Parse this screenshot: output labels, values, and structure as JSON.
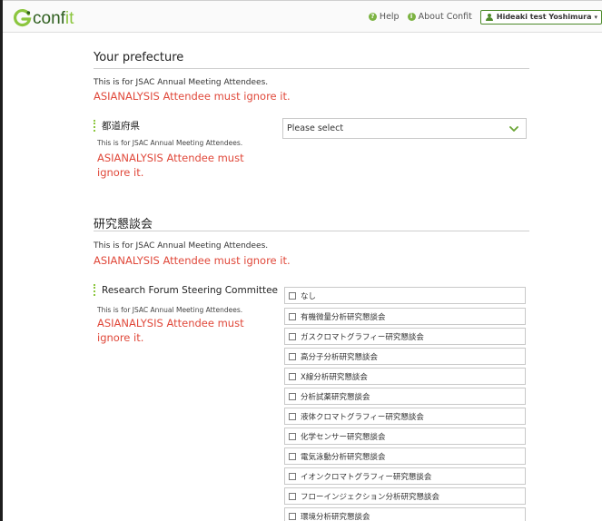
{
  "navbar": {
    "logo_text_main": "conf",
    "logo_text_accent": "it",
    "help_label": "Help",
    "about_label": "About Confit",
    "user_name": "Hideaki test Yoshimura"
  },
  "section_prefecture": {
    "title": "Your prefecture",
    "note": "This is for JSAC Annual Meeting Attendees.",
    "warning": "ASIANALYSIS Attendee must ignore it.",
    "field_label": "都道府県",
    "field_note": "This is for JSAC Annual Meeting Attendees.",
    "field_warning": "ASIANALYSIS Attendee must ignore it.",
    "select_value": "Please select"
  },
  "section_forum": {
    "title": "研究懇談会",
    "note": "This is for JSAC Annual Meeting Attendees.",
    "warning": "ASIANALYSIS Attendee must ignore it.",
    "field_label": "Research Forum Steering Committee",
    "field_note": "This is for JSAC Annual Meeting Attendees.",
    "field_warning": "ASIANALYSIS Attendee must ignore it.",
    "options": [
      "なし",
      "有機微量分析研究懇談会",
      "ガスクロマトグラフィー研究懇談会",
      "高分子分析研究懇談会",
      "X線分析研究懇談会",
      "分析試薬研究懇談会",
      "液体クロマトグラフィー研究懇談会",
      "化学センサー研究懇談会",
      "電気泳動分析研究懇談会",
      "イオンクロマトグラフィー研究懇談会",
      "フローインジェクション分析研究懇談会",
      "環境分析研究懇談会"
    ]
  },
  "colors": {
    "accent_green": "#8cc63f",
    "dark_green": "#4d8a2a",
    "warning_red": "#e0483a"
  }
}
